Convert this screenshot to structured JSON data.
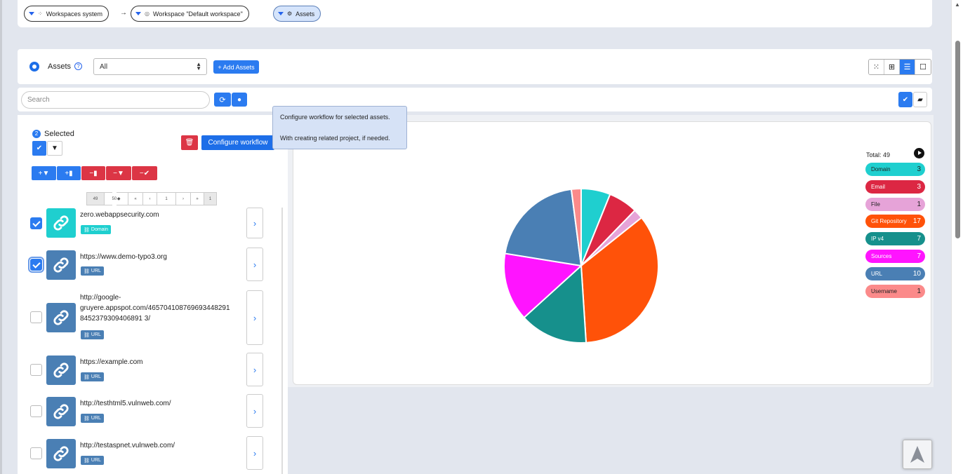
{
  "breadcrumb": [
    {
      "label": "Workspaces system",
      "icon": "grid-icon"
    },
    {
      "label": "Workspace \"Default workspace\"",
      "icon": "target-icon"
    },
    {
      "label": "Assets",
      "icon": "gear-icon"
    }
  ],
  "assets_bar": {
    "title": "Assets",
    "help": "?",
    "filter_value": "All",
    "add_label": "+ Add Assets"
  },
  "search": {
    "placeholder": "Search"
  },
  "selection": {
    "count": "2",
    "label": "Selected",
    "configure_label": "Configure workflow"
  },
  "tooltip": {
    "line1": "Configure workflow for selected assets.",
    "line2": "With creating related project, if needed."
  },
  "pager": {
    "total": "49",
    "per_page": "50",
    "page": "1",
    "pages": "1"
  },
  "assets": [
    {
      "url": "zero.webappsecurity.com",
      "type": "Domain",
      "checked": true
    },
    {
      "url": "https://www.demo-typo3.org",
      "type": "URL",
      "checked": true
    },
    {
      "url": "http://google-gruyere.appspot.com/465704108769693448291845237930940689 13/",
      "type": "URL",
      "checked": false
    },
    {
      "url": "https://example.com",
      "type": "URL",
      "checked": false
    },
    {
      "url": "http://testhtml5.vulnweb.com/",
      "type": "URL",
      "checked": false
    },
    {
      "url": "http://testaspnet.vulnweb.com/",
      "type": "URL",
      "checked": false
    }
  ],
  "url3_lines": [
    "http://google-",
    "gruyere.appspot.com/465704108769693448291",
    "8452379309406891 3/"
  ],
  "chart_data": {
    "type": "pie",
    "total_label": "Total: 49",
    "categories": [
      "Domain",
      "Email",
      "File",
      "Git Repository",
      "IP v4",
      "Sources",
      "URL",
      "Username"
    ],
    "values": [
      3,
      3,
      1,
      17,
      7,
      7,
      10,
      1
    ],
    "colors": [
      "#1fcfcf",
      "#dc2743",
      "#e6a3d8",
      "#ff5209",
      "#16908c",
      "#ff14ff",
      "#4a7fb4",
      "#fb8a8a"
    ],
    "label_colors": [
      "#222222",
      "#ffffff",
      "#222222",
      "#ffffff",
      "#ffffff",
      "#ffffff",
      "#ffffff",
      "#222222"
    ],
    "legend_bg": [
      "#1fcfcf",
      "#dc2743",
      "#e6a3d8",
      "#ff5209",
      "#16908c",
      "#ff14ff",
      "#4a7fb4",
      "#fb8a8a"
    ]
  }
}
